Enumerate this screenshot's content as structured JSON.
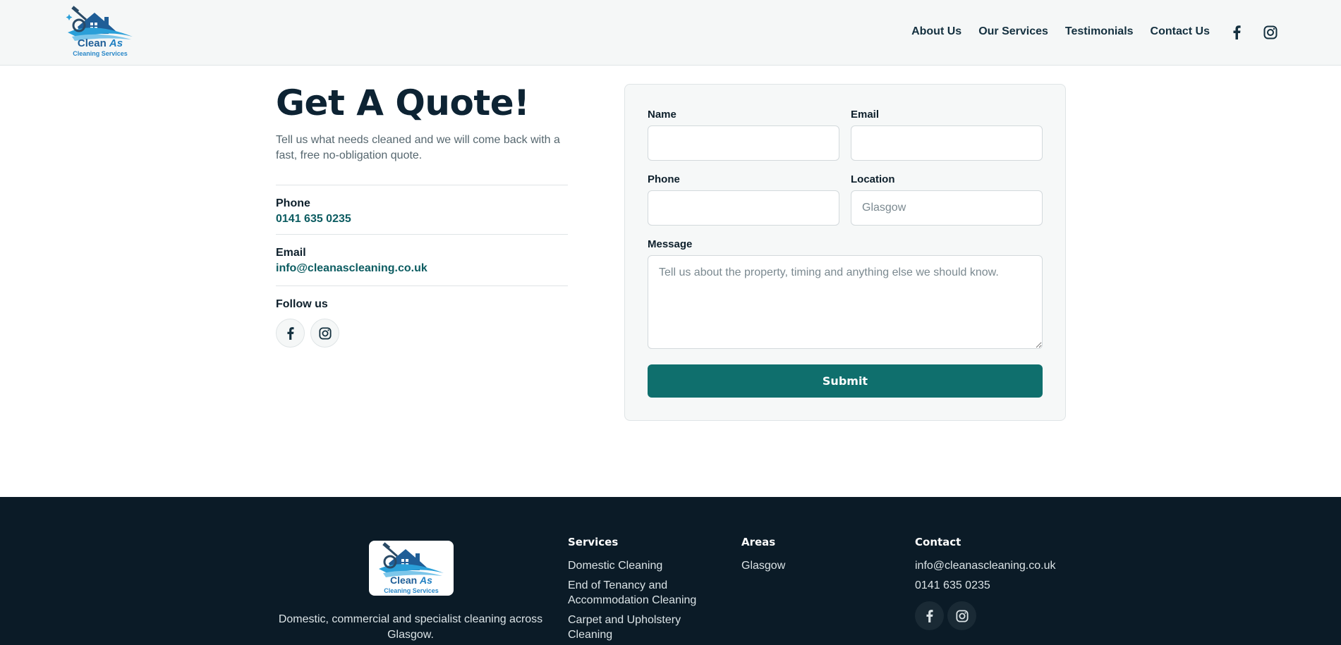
{
  "header": {
    "logo_line1": "Clean",
    "logo_line1_accent": "As",
    "logo_line2": "Cleaning Services",
    "nav": [
      {
        "label": "About Us"
      },
      {
        "label": "Our Services"
      },
      {
        "label": "Testimonials"
      },
      {
        "label": "Contact Us"
      }
    ],
    "social_icons": [
      "facebook-icon",
      "instagram-icon"
    ]
  },
  "intro": {
    "title": "Get A Quote!",
    "description": "Tell us what needs cleaned and we will come back with a fast, free no-obligation quote.",
    "phone_label": "Phone",
    "phone_value": "0141 635 0235",
    "email_label": "Email",
    "email_value": "info@cleanascleaning.co.uk",
    "follow_label": "Follow us"
  },
  "form": {
    "name_label": "Name",
    "name_value": "",
    "email_label": "Email",
    "email_value": "",
    "phone_label": "Phone",
    "phone_value": "",
    "location_label": "Location",
    "location_placeholder": "Glasgow",
    "message_label": "Message",
    "message_placeholder": "Tell us about the property, timing and anything else we should know.",
    "submit_label": "Submit"
  },
  "footer": {
    "logo_line1": "Clean",
    "logo_line1_accent": "As",
    "logo_line2": "Cleaning Services",
    "tagline": "Domestic, commercial and specialist cleaning across Glasgow.",
    "services_heading": "Services",
    "services": [
      {
        "label": "Domestic Cleaning"
      },
      {
        "label": "End of Tenancy and Accommodation Cleaning"
      },
      {
        "label": "Carpet and Upholstery Cleaning"
      }
    ],
    "areas_heading": "Areas",
    "areas": [
      {
        "label": "Glasgow"
      }
    ],
    "contact_heading": "Contact",
    "contact_email": "info@cleanascleaning.co.uk",
    "contact_phone": "0141 635 0235"
  },
  "colors": {
    "brand_teal": "#0f6f6d",
    "footer_bg": "#0b1b27",
    "header_bg": "#f5f7f7",
    "logo_blue": "#1f7fc2"
  }
}
